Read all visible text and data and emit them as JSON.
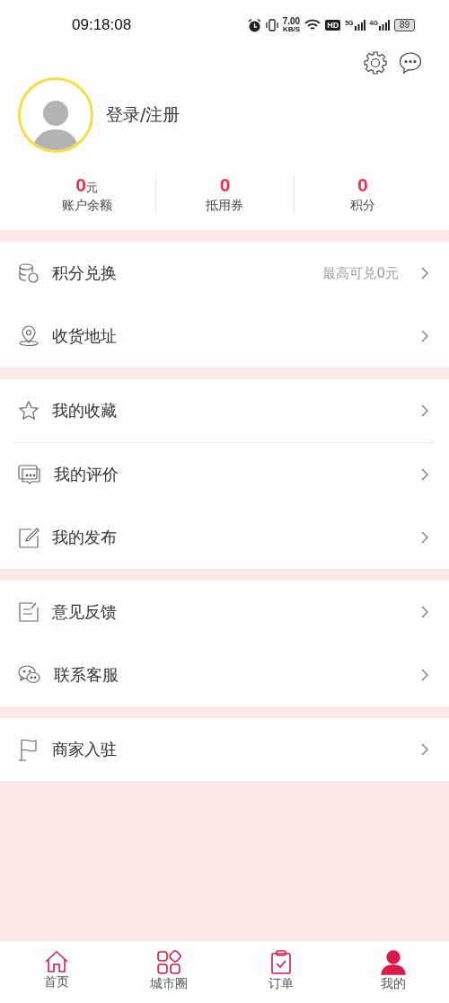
{
  "status_bar": {
    "time": "09:18:08",
    "speed_value": "7.00",
    "speed_unit": "KB/S",
    "hd": "HD",
    "network_1": "5G",
    "network_2": "4G",
    "battery": "89"
  },
  "profile": {
    "login_label": "登录/注册"
  },
  "stats": [
    {
      "value": "0",
      "unit": "元",
      "label": "账户余额"
    },
    {
      "value": "0",
      "label": "抵用券"
    },
    {
      "value": "0",
      "label": "积分"
    }
  ],
  "menu_groups": [
    {
      "items": [
        {
          "label": "积分兑换",
          "hint": "最高可兑0元",
          "divider_below": false
        },
        {
          "label": "收货地址",
          "divider_below": false
        }
      ]
    },
    {
      "items": [
        {
          "label": "我的收藏",
          "divider_below": true
        },
        {
          "label": "我的评价",
          "divider_below": false
        },
        {
          "label": "我的发布",
          "divider_below": false
        }
      ]
    },
    {
      "items": [
        {
          "label": "意见反馈",
          "divider_below": false
        },
        {
          "label": "联系客服",
          "divider_below": false
        }
      ]
    },
    {
      "items": [
        {
          "label": "商家入驻",
          "divider_below": false
        }
      ]
    }
  ],
  "tab_bar": [
    {
      "label": "首页",
      "selected": false
    },
    {
      "label": "城市圈",
      "selected": false
    },
    {
      "label": "订单",
      "selected": false
    },
    {
      "label": "我的",
      "selected": true
    }
  ]
}
